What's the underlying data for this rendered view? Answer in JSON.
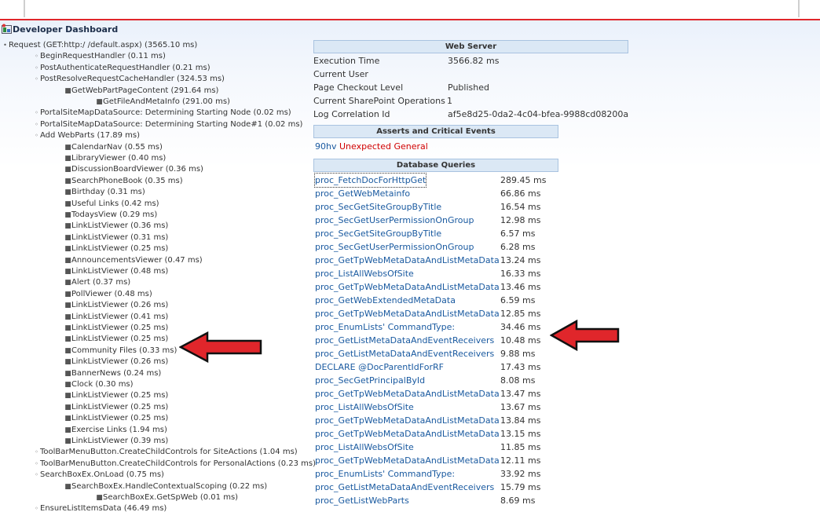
{
  "dashboard": {
    "title": "Developer Dashboard",
    "request": "Request (GET:http:/          /default.aspx) (3565.10 ms)"
  },
  "tree": [
    {
      "level": 1,
      "text": "BeginRequestHandler (0.11 ms)"
    },
    {
      "level": 1,
      "text": "PostAuthenticateRequestHandler (0.21 ms)"
    },
    {
      "level": 1,
      "text": "PostResolveRequestCacheHandler (324.53 ms)"
    },
    {
      "level": 2,
      "text": "GetWebPartPageContent (291.64 ms)"
    },
    {
      "level": 3,
      "text": "GetFileAndMetaInfo (291.00 ms)"
    },
    {
      "level": 1,
      "text": "PortalSiteMapDataSource: Determining Starting Node (0.02 ms)"
    },
    {
      "level": 1,
      "text": "PortalSiteMapDataSource: Determining Starting Node#1 (0.02 ms)"
    },
    {
      "level": 1,
      "text": "Add WebParts (17.89 ms)"
    },
    {
      "level": 2,
      "text": "CalendarNav (0.55 ms)"
    },
    {
      "level": 2,
      "text": "LibraryViewer (0.40 ms)"
    },
    {
      "level": 2,
      "text": "DiscussionBoardViewer (0.36 ms)"
    },
    {
      "level": 2,
      "text": "SearchPhoneBook (0.35 ms)"
    },
    {
      "level": 2,
      "text": "Birthday (0.31 ms)"
    },
    {
      "level": 2,
      "text": "Useful Links (0.42 ms)"
    },
    {
      "level": 2,
      "text": "TodaysView (0.29 ms)"
    },
    {
      "level": 2,
      "text": "LinkListViewer (0.36 ms)"
    },
    {
      "level": 2,
      "text": "LinkListViewer (0.31 ms)"
    },
    {
      "level": 2,
      "text": "LinkListViewer (0.25 ms)"
    },
    {
      "level": 2,
      "text": "AnnouncementsViewer (0.47 ms)"
    },
    {
      "level": 2,
      "text": "LinkListViewer (0.48 ms)"
    },
    {
      "level": 2,
      "text": "Alert (0.37 ms)"
    },
    {
      "level": 2,
      "text": "PollViewer (0.48 ms)"
    },
    {
      "level": 2,
      "text": "LinkListViewer (0.26 ms)"
    },
    {
      "level": 2,
      "text": "LinkListViewer (0.41 ms)"
    },
    {
      "level": 2,
      "text": "LinkListViewer (0.25 ms)"
    },
    {
      "level": 2,
      "text": "LinkListViewer (0.25 ms)"
    },
    {
      "level": 2,
      "text": "Community Files (0.33 ms)"
    },
    {
      "level": 2,
      "text": "LinkListViewer (0.26 ms)"
    },
    {
      "level": 2,
      "text": "BannerNews (0.24 ms)"
    },
    {
      "level": 2,
      "text": "Clock (0.30 ms)"
    },
    {
      "level": 2,
      "text": "LinkListViewer (0.25 ms)"
    },
    {
      "level": 2,
      "text": "LinkListViewer (0.25 ms)"
    },
    {
      "level": 2,
      "text": "LinkListViewer (0.25 ms)"
    },
    {
      "level": 2,
      "text": "Exercise Links (1.94 ms)"
    },
    {
      "level": 2,
      "text": "LinkListViewer (0.39 ms)"
    },
    {
      "level": 1,
      "text": "ToolBarMenuButton.CreateChildControls for SiteActions (1.04 ms)"
    },
    {
      "level": 1,
      "text": "ToolBarMenuButton.CreateChildControls for PersonalActions (0.23 ms)"
    },
    {
      "level": 1,
      "text": "SearchBoxEx.OnLoad (0.75 ms)"
    },
    {
      "level": 2,
      "text": "SearchBoxEx.HandleContextualScoping (0.22 ms)"
    },
    {
      "level": 3,
      "text": "SearchBoxEx.GetSpWeb (0.01 ms)"
    },
    {
      "level": 1,
      "text": "EnsureListItemsData (46.49 ms)"
    }
  ],
  "web_server": {
    "header": "Web Server",
    "rows": [
      {
        "label": "Execution Time",
        "value": "3566.82 ms"
      },
      {
        "label": "Current User",
        "value": ""
      },
      {
        "label": "Page Checkout Level",
        "value": "Published"
      },
      {
        "label": "Current SharePoint Operations",
        "value": "1"
      },
      {
        "label": "Log Correlation Id",
        "value": "af5e8d25-0da2-4c04-bfea-9988cd08200a"
      }
    ]
  },
  "asserts": {
    "header": "Asserts and Critical Events",
    "code": "90hv",
    "message": "Unexpected General"
  },
  "db": {
    "header": "Database Queries",
    "queries": [
      {
        "name": "proc_FetchDocForHttpGet",
        "time": "289.45 ms"
      },
      {
        "name": "proc_GetWebMetainfo",
        "time": "66.86 ms"
      },
      {
        "name": "proc_SecGetSiteGroupByTitle",
        "time": "16.54 ms"
      },
      {
        "name": "proc_SecGetUserPermissionOnGroup",
        "time": "12.98 ms"
      },
      {
        "name": "proc_SecGetSiteGroupByTitle",
        "time": "6.57 ms"
      },
      {
        "name": "proc_SecGetUserPermissionOnGroup",
        "time": "6.28 ms"
      },
      {
        "name": "proc_GetTpWebMetaDataAndListMetaData",
        "time": "13.24 ms"
      },
      {
        "name": "proc_ListAllWebsOfSite",
        "time": "16.33 ms"
      },
      {
        "name": "proc_GetTpWebMetaDataAndListMetaData",
        "time": "13.46 ms"
      },
      {
        "name": "proc_GetWebExtendedMetaData",
        "time": "6.59 ms"
      },
      {
        "name": "proc_GetTpWebMetaDataAndListMetaData",
        "time": "12.85 ms"
      },
      {
        "name": "proc_EnumLists' CommandType:",
        "time": "34.46 ms"
      },
      {
        "name": "proc_GetListMetaDataAndEventReceivers",
        "time": "10.48 ms"
      },
      {
        "name": "proc_GetListMetaDataAndEventReceivers",
        "time": "9.88 ms"
      },
      {
        "name": "DECLARE @DocParentIdForRF",
        "time": "17.43 ms"
      },
      {
        "name": "proc_SecGetPrincipalById",
        "time": "8.08 ms"
      },
      {
        "name": "proc_GetTpWebMetaDataAndListMetaData",
        "time": "13.47 ms"
      },
      {
        "name": "proc_ListAllWebsOfSite",
        "time": "13.67 ms"
      },
      {
        "name": "proc_GetTpWebMetaDataAndListMetaData",
        "time": "13.84 ms"
      },
      {
        "name": "proc_GetTpWebMetaDataAndListMetaData",
        "time": "13.15 ms"
      },
      {
        "name": "proc_ListAllWebsOfSite",
        "time": "11.85 ms"
      },
      {
        "name": "proc_GetTpWebMetaDataAndListMetaData",
        "time": "12.11 ms"
      },
      {
        "name": "proc_EnumLists' CommandType:",
        "time": "33.92 ms"
      },
      {
        "name": "proc_GetListMetaDataAndEventReceivers",
        "time": "15.79 ms"
      },
      {
        "name": "proc_GetListWebParts",
        "time": "8.69 ms"
      }
    ]
  },
  "colors": {
    "accent_red": "#e0262b",
    "link_blue": "#1a5aa0",
    "header_bg": "#dbe8f5"
  }
}
